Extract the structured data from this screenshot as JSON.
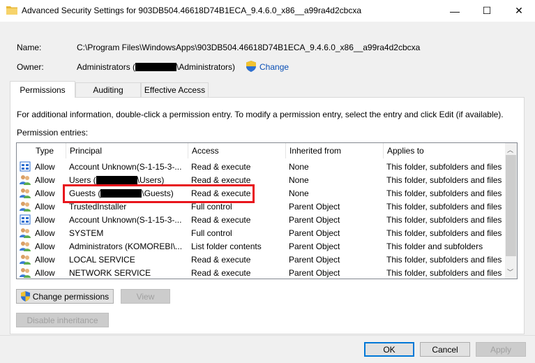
{
  "window": {
    "title": "Advanced Security Settings for 903DB504.46618D74B1ECA_9.4.6.0_x86__a99ra4d2cbcxa",
    "minimize_glyph": "—",
    "maximize_glyph": "☐",
    "close_glyph": "✕"
  },
  "header": {
    "name_label": "Name:",
    "name_value": "C:\\Program Files\\WindowsApps\\903DB504.46618D74B1ECA_9.4.6.0_x86__a99ra4d2cbcxa",
    "owner_label": "Owner:",
    "owner_prefix": "Administrators (",
    "owner_suffix": "\\Administrators)",
    "change_label": "Change"
  },
  "tabs": [
    {
      "label": "Permissions",
      "active": true
    },
    {
      "label": "Auditing",
      "active": false
    },
    {
      "label": "Effective Access",
      "active": false
    }
  ],
  "permissions": {
    "info_text": "For additional information, double-click a permission entry. To modify a permission entry, select the entry and click Edit (if available).",
    "entries_label": "Permission entries:",
    "columns": [
      "Type",
      "Principal",
      "Access",
      "Inherited from",
      "Applies to"
    ],
    "rows": [
      {
        "icon": "app-package-icon",
        "type": "Allow",
        "principal": "Account Unknown(S-1-15-3-...",
        "principal_suffix": "",
        "access": "Read & execute",
        "inherited": "None",
        "applies": "This folder, subfolders and files"
      },
      {
        "icon": "users-icon",
        "type": "Allow",
        "principal": "Users (",
        "principal_suffix": "\\Users)",
        "access": "Read & execute",
        "inherited": "None",
        "applies": "This folder, subfolders and files"
      },
      {
        "icon": "users-icon",
        "type": "Allow",
        "principal": "Guests (",
        "principal_suffix": "\\Guests)",
        "access": "Read & execute",
        "inherited": "None",
        "applies": "This folder, subfolders and files"
      },
      {
        "icon": "users-icon",
        "type": "Allow",
        "principal": "TrustedInstaller",
        "principal_suffix": "",
        "access": "Full control",
        "inherited": "Parent Object",
        "applies": "This folder, subfolders and files"
      },
      {
        "icon": "app-package-icon",
        "type": "Allow",
        "principal": "Account Unknown(S-1-15-3-...",
        "principal_suffix": "",
        "access": "Read & execute",
        "inherited": "Parent Object",
        "applies": "This folder, subfolders and files"
      },
      {
        "icon": "users-icon",
        "type": "Allow",
        "principal": "SYSTEM",
        "principal_suffix": "",
        "access": "Full control",
        "inherited": "Parent Object",
        "applies": "This folder, subfolders and files"
      },
      {
        "icon": "users-icon",
        "type": "Allow",
        "principal": "Administrators (KOMOREBI\\...",
        "principal_suffix": "",
        "access": "List folder contents",
        "inherited": "Parent Object",
        "applies": "This folder and subfolders"
      },
      {
        "icon": "users-icon",
        "type": "Allow",
        "principal": "LOCAL SERVICE",
        "principal_suffix": "",
        "access": "Read & execute",
        "inherited": "Parent Object",
        "applies": "This folder, subfolders and files"
      },
      {
        "icon": "users-icon",
        "type": "Allow",
        "principal": "NETWORK SERVICE",
        "principal_suffix": "",
        "access": "Read & execute",
        "inherited": "Parent Object",
        "applies": "This folder, subfolders and files"
      }
    ]
  },
  "buttons": {
    "change_permissions": "Change permissions",
    "view": "View",
    "disable_inheritance": "Disable inheritance",
    "ok": "OK",
    "cancel": "Cancel",
    "apply": "Apply"
  },
  "colors": {
    "highlight": "#e8151c",
    "link": "#0a4fb5",
    "accent": "#0078d7"
  }
}
